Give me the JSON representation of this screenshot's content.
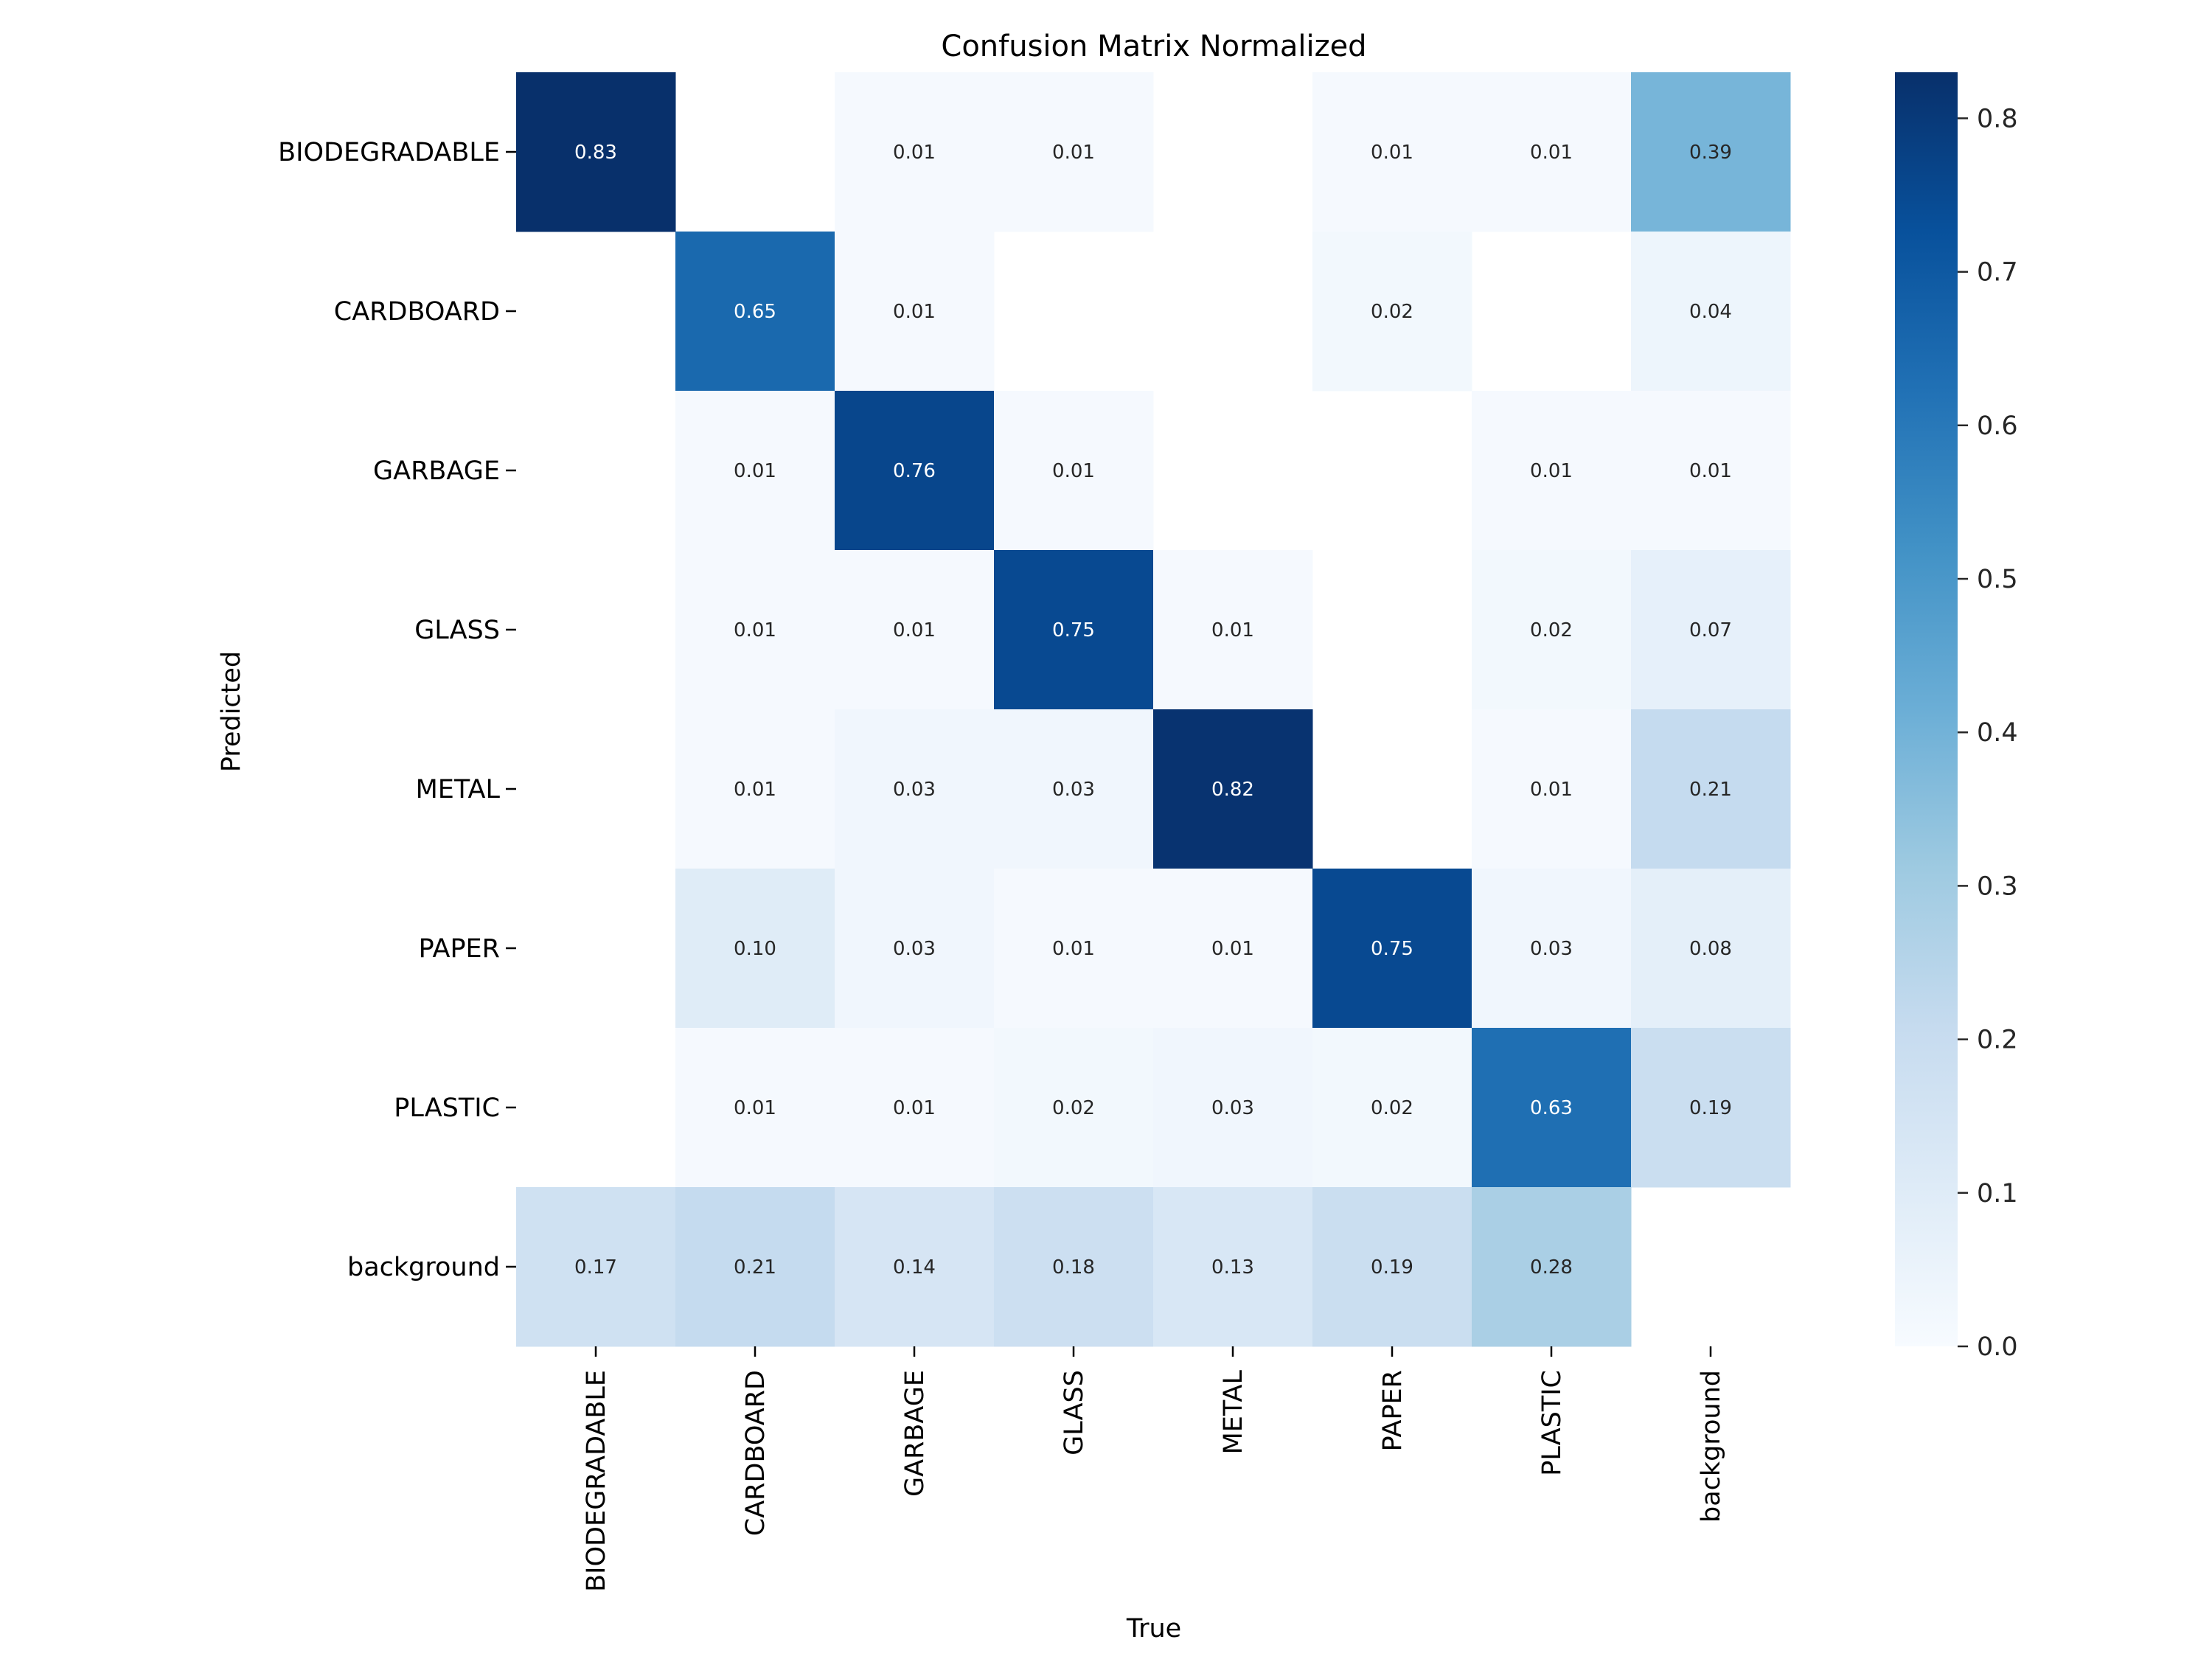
{
  "chart_data": {
    "type": "heatmap",
    "title": "Confusion Matrix Normalized",
    "xlabel": "True",
    "ylabel": "Predicted",
    "x_categories": [
      "BIODEGRADABLE",
      "CARDBOARD",
      "GARBAGE",
      "GLASS",
      "METAL",
      "PAPER",
      "PLASTIC",
      "background"
    ],
    "y_categories": [
      "BIODEGRADABLE",
      "CARDBOARD",
      "GARBAGE",
      "GLASS",
      "METAL",
      "PAPER",
      "PLASTIC",
      "background"
    ],
    "values": [
      [
        0.83,
        null,
        0.01,
        0.01,
        null,
        0.01,
        0.01,
        0.39
      ],
      [
        null,
        0.65,
        0.01,
        null,
        null,
        0.02,
        null,
        0.04
      ],
      [
        null,
        0.01,
        0.76,
        0.01,
        null,
        null,
        0.01,
        0.01
      ],
      [
        null,
        0.01,
        0.01,
        0.75,
        0.01,
        null,
        0.02,
        0.07
      ],
      [
        null,
        0.01,
        0.03,
        0.03,
        0.82,
        null,
        0.01,
        0.21
      ],
      [
        null,
        0.1,
        0.03,
        0.01,
        0.01,
        0.75,
        0.03,
        0.08
      ],
      [
        null,
        0.01,
        0.01,
        0.02,
        0.03,
        0.02,
        0.63,
        0.19
      ],
      [
        0.17,
        0.21,
        0.14,
        0.18,
        0.13,
        0.19,
        0.28,
        null
      ]
    ],
    "colormap": "Blues",
    "colorbar": {
      "range": [
        0.0,
        0.83
      ],
      "ticks": [
        0.0,
        0.1,
        0.2,
        0.3,
        0.4,
        0.5,
        0.6,
        0.7,
        0.8
      ],
      "tick_labels": [
        "0.0",
        "0.1",
        "0.2",
        "0.3",
        "0.4",
        "0.5",
        "0.6",
        "0.7",
        "0.8"
      ]
    },
    "annotation_format": "0.00",
    "grid": false,
    "legend": "colorbar-right"
  }
}
